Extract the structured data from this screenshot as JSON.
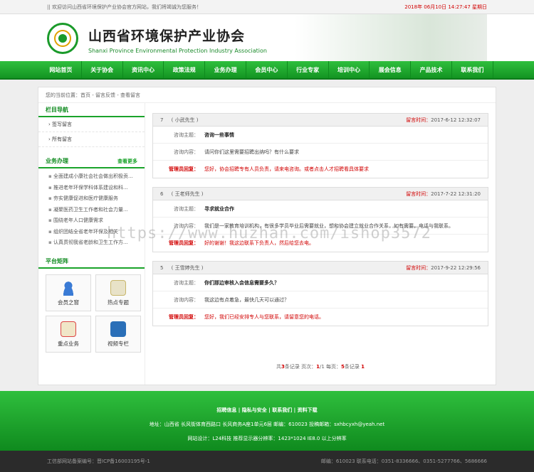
{
  "topbar": {
    "welcome": "|| 欢迎访问山西省环境保护产业协会官方网站，我们将竭诚为您服务！",
    "date": "2018年 06月10日  14:27:47  星期日"
  },
  "header": {
    "title_cn": "山西省环境保护产业协会",
    "title_en": "Shanxi Province Environmental Protection Industry Association"
  },
  "nav": [
    "网站首页",
    "关于协会",
    "资讯中心",
    "政策法规",
    "业务办理",
    "会员中心",
    "行业专家",
    "培训中心",
    "展会信息",
    "产品技术",
    "联系我们"
  ],
  "breadcrumb": "您的当前位置：首页 - 留言反馈 - 查看留言",
  "sidebar": {
    "nav_title": "栏目导航",
    "nav_items": [
      "›  签写留言",
      "›  所有留言"
    ],
    "business_title": "业务办理",
    "business_more": "查看更多",
    "business_items": [
      "全面建成小康社会社会做出积极贡...",
      "推进老年环保学科体系建设和科...",
      "夯实健康促进和医疗健康服务",
      "凝聚医药卫生工作者和社会力量...",
      "围绕老年人口健康需求",
      "组织团结全省老年环保及相关",
      "认真贯彻我省老龄和卫生工作方..."
    ],
    "platform_title": "平台矩阵",
    "tiles": [
      "会员之窗",
      "热点专题",
      "重点业务",
      "视频专栏"
    ]
  },
  "messages": [
    {
      "no": "7",
      "name": "( 小武先生 )",
      "time_label": "留言时间：",
      "time": "2017-6-12 12:32:07",
      "subject_label": "咨询主题：",
      "subject": "咨询一些事情",
      "content_label": "咨询内容：",
      "content": "请问你们这里需要招聘出纳吗？有什么要求",
      "reply_label": "管理员回复：",
      "reply": "您好，协会招聘专有人员负责，请来电咨询。或者点击人才招聘看具体要求"
    },
    {
      "no": "6",
      "name": "( 王老师先生 )",
      "time_label": "留言时间：",
      "time": "2017-7-22 12:31:20",
      "subject_label": "咨询主题：",
      "subject": "寻求就业合作",
      "content_label": "咨询内容：",
      "content": "我们是一家教育培训机构，有很多学员毕业后需要就业，想和协会建立就业合作关系，如有需要，电话与我联系。",
      "reply_label": "管理员回复：",
      "reply": "好的谢谢！我这边联系下负责人，然后给您去电。"
    },
    {
      "no": "5",
      "name": "( 王雪婷先生 )",
      "time_label": "留言时间：",
      "time": "2017-9-22 12:29:56",
      "subject_label": "咨询主题：",
      "subject": "你们那边审核入会信息需要多久？",
      "content_label": "咨询内容：",
      "content": "我这边有点着急，最快几天可以通过？",
      "reply_label": "管理员回复：",
      "reply": "您好，我们已经安排专人与您联系，请留意您的电话。"
    }
  ],
  "pager": {
    "prefix": "共",
    "total": "3",
    "mid": "条记录    页次：",
    "page": "1",
    "pages": "/1 每页：",
    "per": "5",
    "suffix": "条记录     ",
    "current": "1"
  },
  "footer": {
    "links": "招聘信息  |  隐私与安全  |  联系我们  |  资料下载",
    "address": "地址：山西省 长风街体育西路口 长风商务A座1单元6层   邮编：610023   投稿邮箱：sxhbcyxh@yeah.net",
    "design": "网站设计：L24科技   推荐显示器分辨率：1423*1024  IE8.0 以上分辨率"
  },
  "bottombar": {
    "icp": "工信部网站备案编号：晋ICP备16003195号-1",
    "contact": "邮编：610023   联系电话：0351-8336666、0351-5277766、5686666"
  },
  "watermark": "https://www.huzhan.com/ishop3572",
  "colors": {
    "brand_green": "#1aa32a",
    "alert_red": "#d10000"
  }
}
